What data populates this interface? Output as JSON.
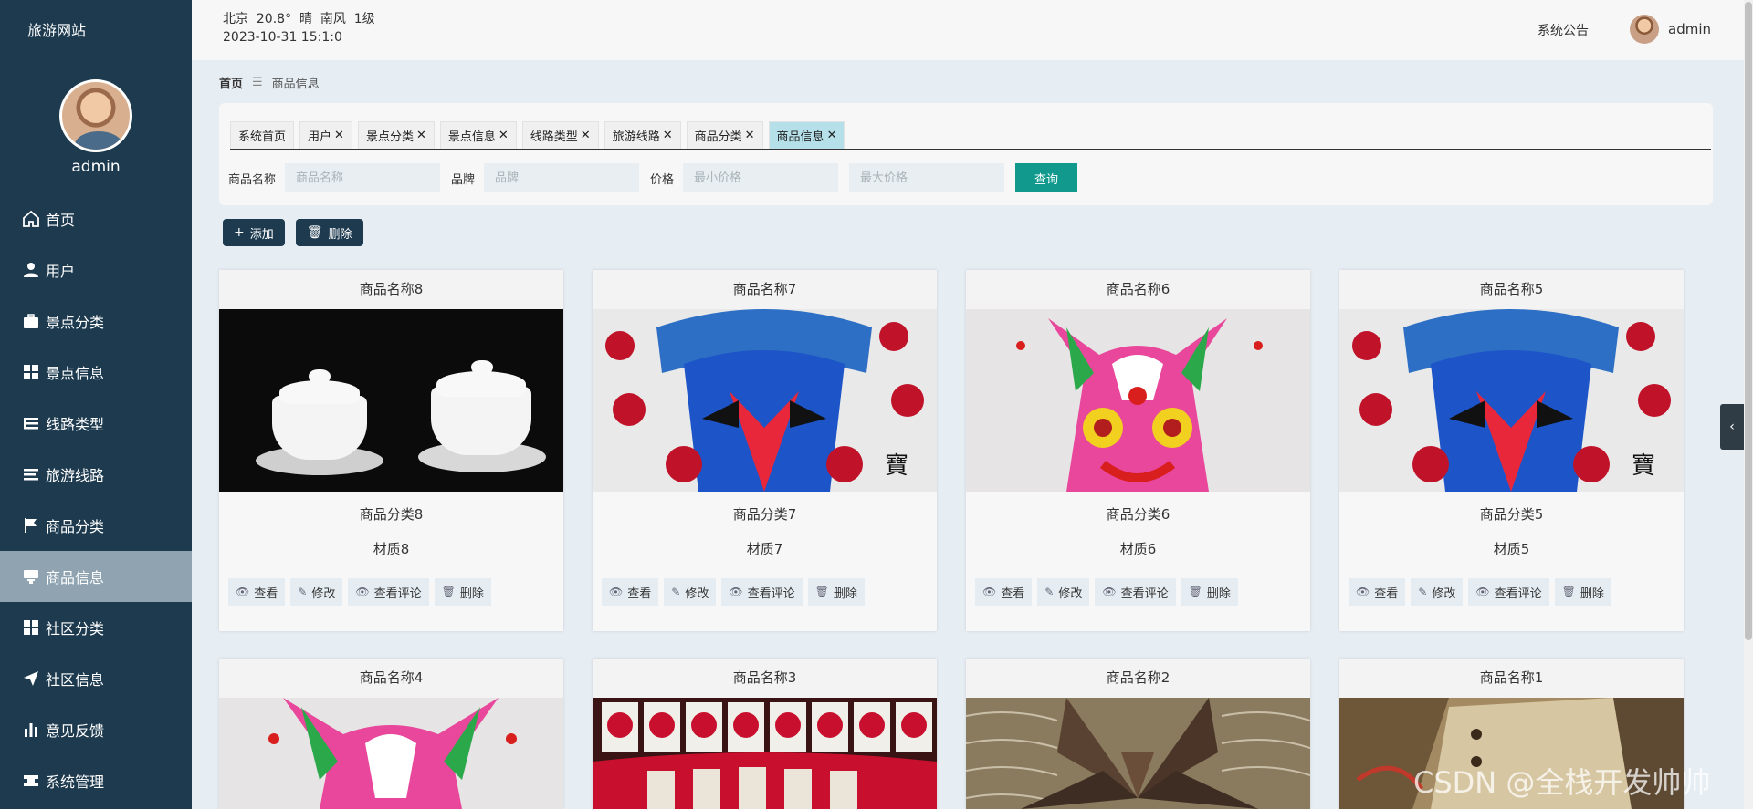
{
  "app": {
    "brand": "旅游网站"
  },
  "sidebar": {
    "username": "admin",
    "items": [
      {
        "label": "首页",
        "icon": "home-icon",
        "active": false
      },
      {
        "label": "用户",
        "icon": "user-icon",
        "active": false
      },
      {
        "label": "景点分类",
        "icon": "briefcase-icon",
        "active": false
      },
      {
        "label": "景点信息",
        "icon": "grid-icon",
        "active": false
      },
      {
        "label": "线路类型",
        "icon": "list-icon",
        "active": false
      },
      {
        "label": "旅游线路",
        "icon": "list-lines-icon",
        "active": false
      },
      {
        "label": "商品分类",
        "icon": "flag-icon",
        "active": false
      },
      {
        "label": "商品信息",
        "icon": "product-icon",
        "active": true
      },
      {
        "label": "社区分类",
        "icon": "grid-icon",
        "active": false
      },
      {
        "label": "社区信息",
        "icon": "send-icon",
        "active": false
      },
      {
        "label": "意见反馈",
        "icon": "bar-chart-icon",
        "active": false
      },
      {
        "label": "系统管理",
        "icon": "settings-icon",
        "active": false
      }
    ]
  },
  "header": {
    "weather": "北京  20.8°  晴  南风  1级",
    "datetime": "2023-10-31 15:1:0",
    "notice": "系统公告",
    "username": "admin"
  },
  "breadcrumb": {
    "home": "首页",
    "current": "商品信息"
  },
  "tabs": [
    {
      "label": "系统首页",
      "closable": false,
      "active": false
    },
    {
      "label": "用户",
      "closable": true,
      "active": false
    },
    {
      "label": "景点分类",
      "closable": true,
      "active": false
    },
    {
      "label": "景点信息",
      "closable": true,
      "active": false
    },
    {
      "label": "线路类型",
      "closable": true,
      "active": false
    },
    {
      "label": "旅游线路",
      "closable": true,
      "active": false
    },
    {
      "label": "商品分类",
      "closable": true,
      "active": false
    },
    {
      "label": "商品信息",
      "closable": true,
      "active": true
    }
  ],
  "search": {
    "name_label": "商品名称",
    "name_placeholder": "商品名称",
    "brand_label": "品牌",
    "brand_placeholder": "品牌",
    "price_label": "价格",
    "min_price_placeholder": "最小价格",
    "max_price_placeholder": "最大价格",
    "query_button": "查询"
  },
  "actions": {
    "add": "添加",
    "delete": "删除"
  },
  "card_ops": {
    "view": "查看",
    "edit": "修改",
    "view_comments": "查看评论",
    "delete": "删除"
  },
  "products": [
    {
      "name": "商品名称8",
      "category": "商品分类8",
      "material": "材质8",
      "image": "tea-set"
    },
    {
      "name": "商品名称7",
      "category": "商品分类7",
      "material": "材质7",
      "image": "opera-mask"
    },
    {
      "name": "商品名称6",
      "category": "商品分类6",
      "material": "材质6",
      "image": "tiger-mask"
    },
    {
      "name": "商品名称5",
      "category": "商品分类5",
      "material": "材质5",
      "image": "opera-mask"
    },
    {
      "name": "商品名称4",
      "category": "",
      "material": "",
      "image": "tiger-mask"
    },
    {
      "name": "商品名称3",
      "category": "",
      "material": "",
      "image": "paper-cut"
    },
    {
      "name": "商品名称2",
      "category": "",
      "material": "",
      "image": "fan"
    },
    {
      "name": "商品名称1",
      "category": "",
      "material": "",
      "image": "book"
    }
  ],
  "watermark": "CSDN @全栈开发帅帅",
  "colors": {
    "sidebar": "#1d3a4f",
    "accent": "#11998e",
    "active_tab": "#b5e0ea",
    "active_menu": "#8fa3b1"
  }
}
